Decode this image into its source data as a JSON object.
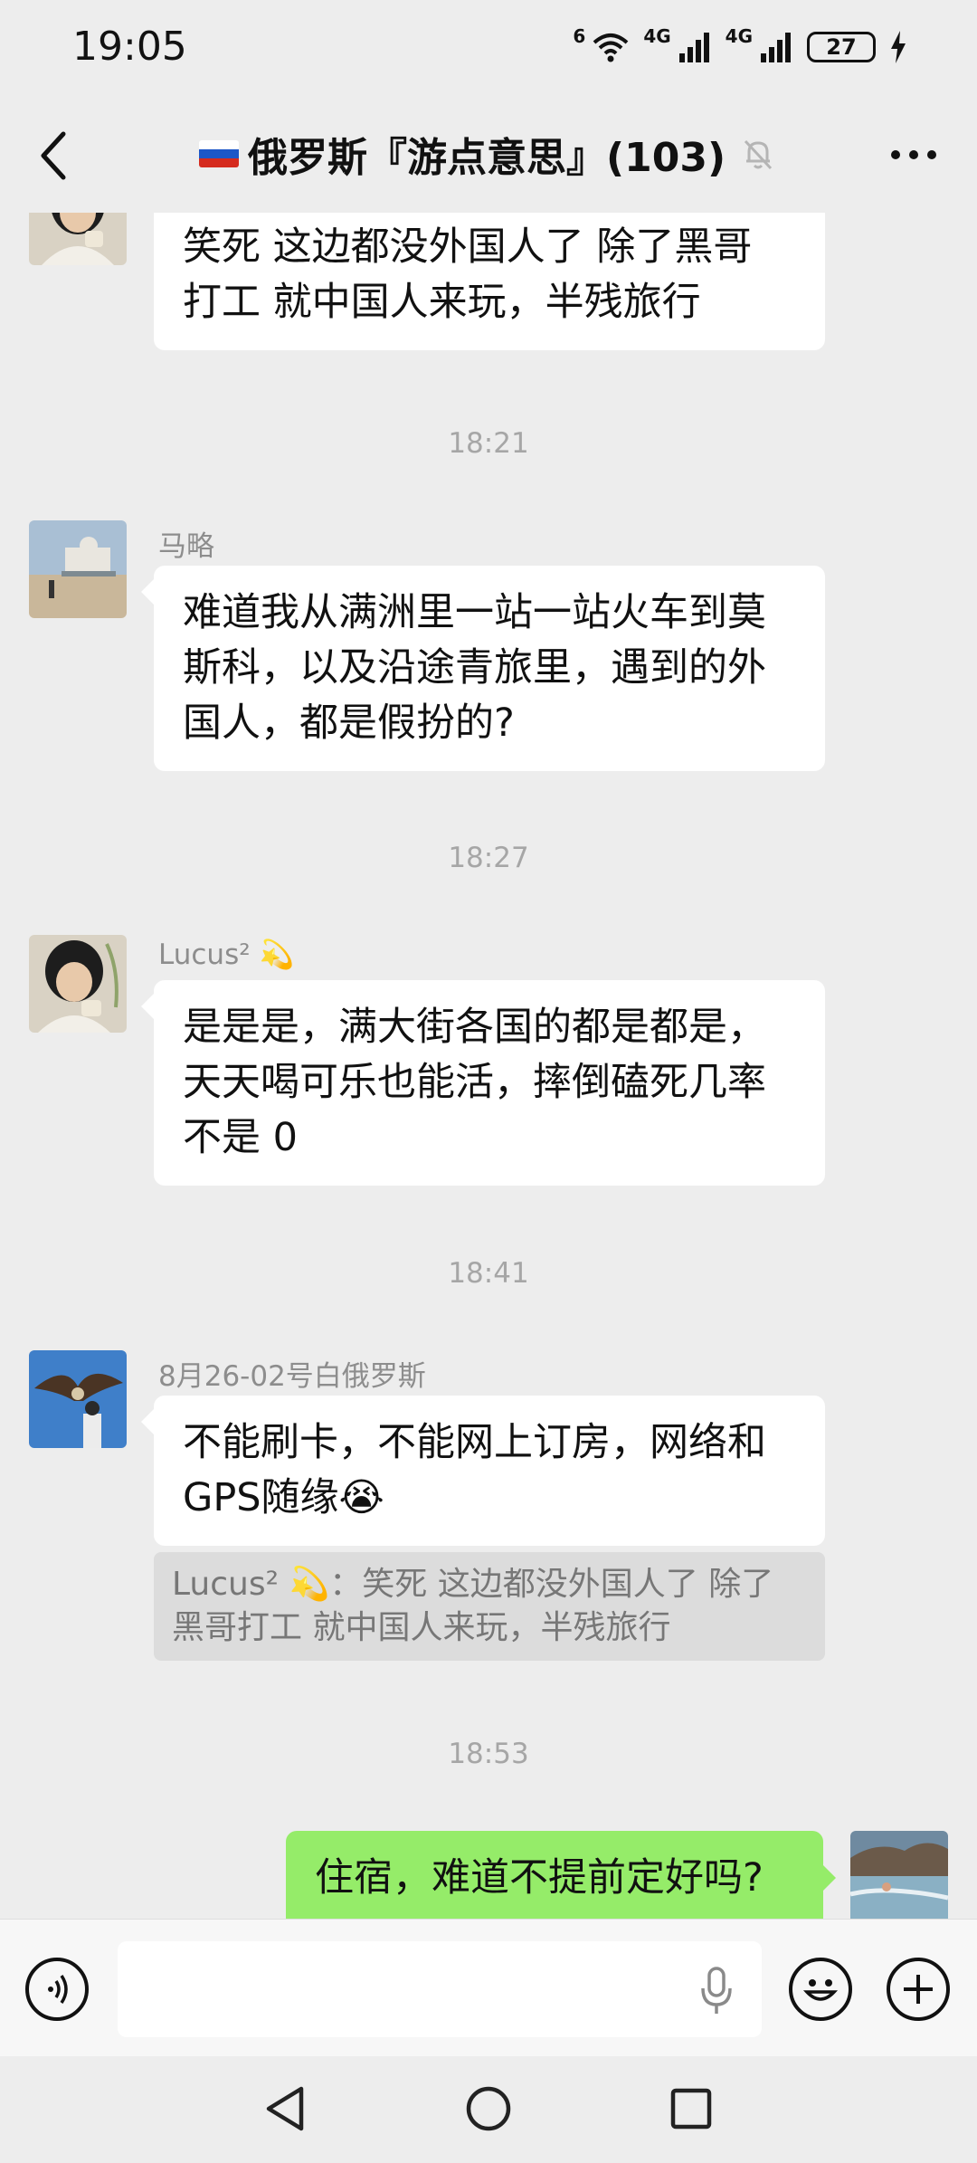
{
  "status_bar": {
    "time": "19:05",
    "wifi_label": "6",
    "signal1_label": "4G",
    "signal2_label": "4G",
    "battery": "27"
  },
  "header": {
    "title": "俄罗斯『游点意思』(103)",
    "flag_colors": [
      "#ffffff",
      "#1c57c8",
      "#d52b1e"
    ],
    "icons": [
      "back-arrow-icon",
      "mute-bell-icon",
      "more-dots-icon"
    ]
  },
  "messages": [
    {
      "type": "text",
      "lines": [
        "笑死  这边都没外国人了 除了黑哥",
        "打工  就中国人来玩，半残旅行"
      ]
    },
    {
      "type": "time",
      "text": "18:21"
    },
    {
      "type": "text",
      "sender": "马略",
      "lines": [
        "难道我从满洲里一站一站火车到莫",
        "斯科，以及沿途青旅里，遇到的外",
        "国人，都是假扮的?"
      ]
    },
    {
      "type": "time",
      "text": "18:27"
    },
    {
      "type": "text",
      "sender": "Lucus² 💫",
      "lines": [
        "是是是，满大街各国的都是都是，",
        "天天喝可乐也能活，摔倒磕死几率",
        "不是 0"
      ]
    },
    {
      "type": "time",
      "text": "18:41"
    },
    {
      "type": "text",
      "sender": "8月26-02号白俄罗斯",
      "lines": [
        "不能刷卡，不能网上订房，网络和",
        "GPS随缘😭"
      ],
      "quote_lines": [
        "Lucus² 💫：笑死  这边都没外国人了 除了",
        "黑哥打工  就中国人来玩，半残旅行"
      ]
    },
    {
      "type": "time",
      "text": "18:53"
    },
    {
      "type": "text",
      "mine": true,
      "lines": [
        "住宿，难道不提前定好吗?"
      ]
    }
  ],
  "input_bar": {
    "placeholder": "",
    "icons": [
      "voice-icon",
      "mic-icon",
      "emoji-icon",
      "plus-icon"
    ]
  },
  "nav_bar": {
    "icons": [
      "back-triangle-icon",
      "home-circle-icon",
      "recents-square-icon"
    ]
  },
  "colors": {
    "background": "#ededed",
    "bubble_other": "#ffffff",
    "bubble_mine": "#95ec69",
    "meta_text": "#a6a6a6"
  }
}
